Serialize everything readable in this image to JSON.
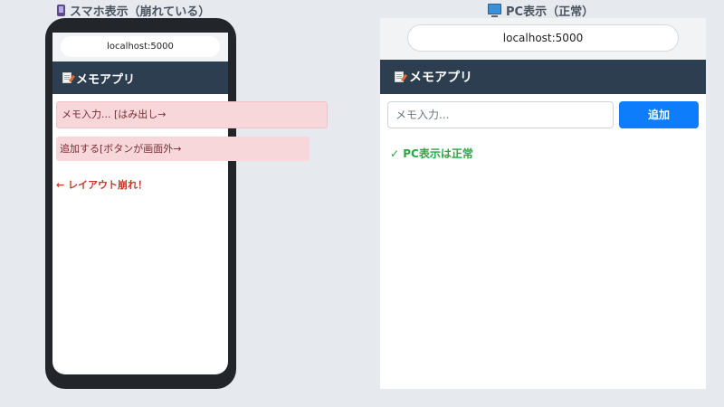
{
  "mobile": {
    "caption": "スマホ表示（崩れている）",
    "caption_icon": "mobile-phone-icon",
    "url": "localhost:5000",
    "app_title": "メモアプリ",
    "app_icon": "memo-icon",
    "input_text": "メモ入力... [はみ出し→",
    "button_text": "追加する[ボタンが画面外→",
    "error_note": "← レイアウト崩れ！",
    "colors": {
      "frame": "#22262b",
      "header": "#2c3e50",
      "error_bg": "#f8d7da",
      "error_text": "#c0392b"
    }
  },
  "pc": {
    "caption": "PC表示（正常）",
    "caption_icon": "desktop-computer-icon",
    "url": "localhost:5000",
    "app_title": "メモアプリ",
    "app_icon": "memo-icon",
    "input_placeholder": "メモ入力...",
    "add_button": "追加",
    "ok_note": "✓ PC表示は正常",
    "colors": {
      "header": "#2c3e50",
      "button": "#0d7dfc",
      "ok_text": "#27a844"
    }
  }
}
